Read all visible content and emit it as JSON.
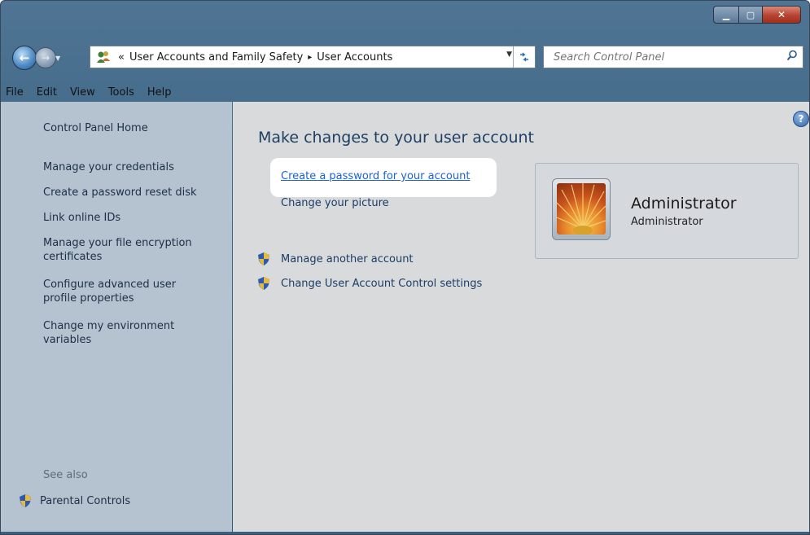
{
  "window": {
    "caption_buttons": {
      "minimize_icon": "minimize-icon",
      "maximize_icon": "maximize-icon",
      "close_icon": "close-icon"
    }
  },
  "navigation": {
    "breadcrumb_overflow": "«",
    "breadcrumb": [
      "User Accounts and Family Safety",
      "User Accounts"
    ],
    "separator": "▸",
    "search_placeholder": "Search Control Panel"
  },
  "menubar": {
    "items": [
      "File",
      "Edit",
      "View",
      "Tools",
      "Help"
    ]
  },
  "sidebar": {
    "home": "Control Panel Home",
    "links": [
      "Manage your credentials",
      "Create a password reset disk",
      "Link online IDs",
      "Manage your file encryption\ncertificates",
      "Configure advanced user\nprofile properties",
      "Change my environment\nvariables"
    ],
    "see_also": "See also",
    "parental_controls": "Parental Controls"
  },
  "main": {
    "title": "Make changes to your user account",
    "create_password": "Create a password for your account",
    "change_picture": "Change your picture",
    "manage_another": "Manage another account",
    "uac_settings": "Change User Account Control settings"
  },
  "account": {
    "name": "Administrator",
    "type": "Administrator"
  },
  "colors": {
    "link": "#1c62d2",
    "title": "#1f3f63",
    "sidebar_bg": "#b5c3d1",
    "content_bg": "#d8dadc"
  }
}
